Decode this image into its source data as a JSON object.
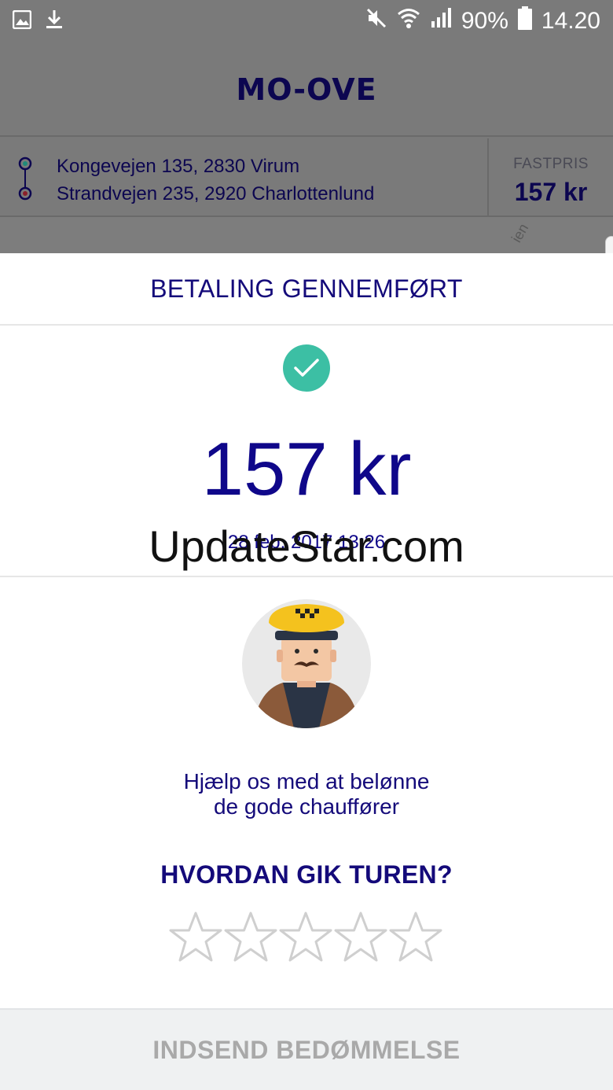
{
  "status_bar": {
    "battery": "90%",
    "time": "14.20",
    "icons": [
      "image-icon",
      "download-icon",
      "mute-icon",
      "wifi-icon",
      "signal-icon",
      "battery-icon"
    ]
  },
  "app": {
    "logo": "MO-OVE"
  },
  "route": {
    "from": "Kongevejen 135, 2830 Virum",
    "to": "Strandvejen 235, 2920 Charlottenlund",
    "price_label": "FASTPRIS",
    "price_value": "157 kr"
  },
  "map": {
    "street_fragment": "ien"
  },
  "dialog": {
    "title": "BETALING GENNEMFØRT",
    "amount": "157 kr",
    "date": "28 feb. 2017 13:26",
    "help_text_line1": "Hjælp os med at belønne",
    "help_text_line2": "de gode chauffører",
    "question": "HVORDAN GIK TUREN?",
    "rating": 0,
    "rating_max": 5,
    "submit_label": "INDSEND BEDØMMELSE"
  },
  "watermark": "UpdateStar.com",
  "colors": {
    "brand_navy": "#140a7a",
    "success_green": "#3cbfa4",
    "disabled_gray": "#a9a9a9"
  }
}
